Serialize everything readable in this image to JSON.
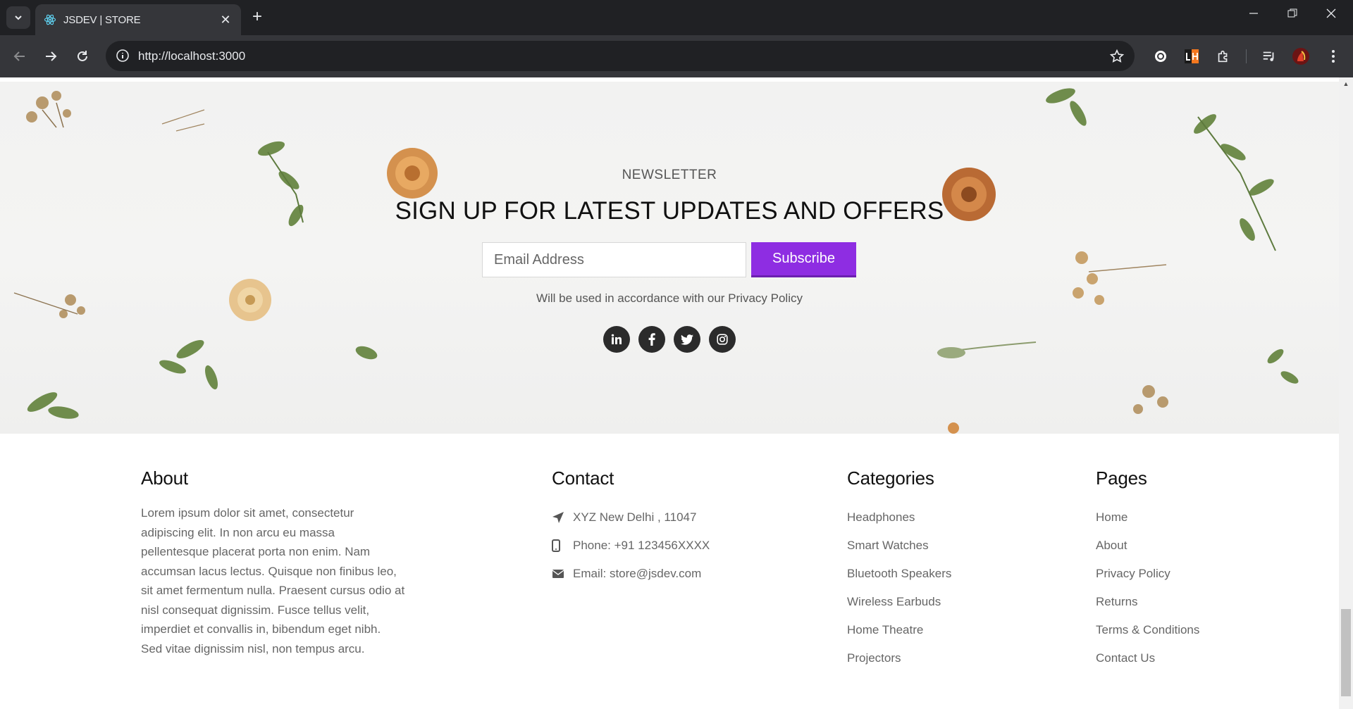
{
  "browser": {
    "tab_title": "JSDEV | STORE",
    "url": "http://localhost:3000"
  },
  "newsletter": {
    "kicker": "NEWSLETTER",
    "headline": "SIGN UP FOR LATEST UPDATES AND OFFERS",
    "email_placeholder": "Email Address",
    "subscribe_label": "Subscribe",
    "policy_text": "Will be used in accordance with our Privacy Policy",
    "socials": [
      "linkedin-icon",
      "facebook-icon",
      "twitter-icon",
      "instagram-icon"
    ],
    "accent_color": "#8e2de2"
  },
  "footer": {
    "about": {
      "title": "About",
      "text": "Lorem ipsum dolor sit amet, consectetur adipiscing elit. In non arcu eu massa pellentesque placerat porta non enim. Nam accumsan lacus lectus. Quisque non finibus leo, sit amet fermentum nulla. Praesent cursus odio at nisl consequat dignissim. Fusce tellus velit, imperdiet et convallis in, bibendum eget nibh. Sed vitae dignissim nisl, non tempus arcu."
    },
    "contact": {
      "title": "Contact",
      "address": "XYZ New Delhi , 11047",
      "phone": "Phone: +91 123456XXXX",
      "email": "Email: store@jsdev.com"
    },
    "categories": {
      "title": "Categories",
      "items": [
        "Headphones",
        "Smart Watches",
        "Bluetooth Speakers",
        "Wireless Earbuds",
        "Home Theatre",
        "Projectors"
      ]
    },
    "pages": {
      "title": "Pages",
      "items": [
        "Home",
        "About",
        "Privacy Policy",
        "Returns",
        "Terms & Conditions",
        "Contact Us"
      ]
    }
  }
}
